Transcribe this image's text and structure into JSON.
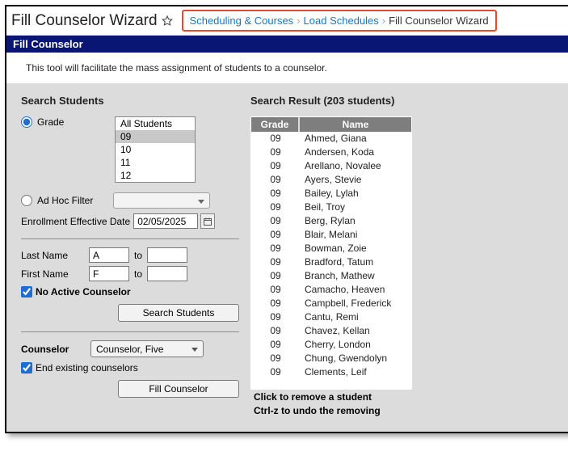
{
  "title": "Fill Counselor Wizard",
  "breadcrumb": {
    "a": "Scheduling & Courses",
    "b": "Load Schedules",
    "c": "Fill Counselor Wizard"
  },
  "banner": "Fill Counselor",
  "intro": "This tool will facilitate the mass assignment of students to a counselor.",
  "search": {
    "heading": "Search Students",
    "grade_label": "Grade",
    "grade_options": {
      "o0": "All Students",
      "o1": "09",
      "o2": "10",
      "o3": "11",
      "o4": "12"
    },
    "adhoc_label": "Ad Hoc Filter",
    "enroll_label": "Enrollment Effective Date",
    "enroll_value": "02/05/2025",
    "lastname_label": "Last Name",
    "lastname_val": "A",
    "to": "to",
    "firstname_label": "First Name",
    "firstname_val": "F",
    "no_active_label": "No Active Counselor",
    "search_btn": "Search Students",
    "counselor_label": "Counselor",
    "counselor_value": "Counselor, Five",
    "end_existing_label": "End existing counselors",
    "fill_btn": "Fill Counselor"
  },
  "results": {
    "heading": "Search Result (203 students)",
    "col_grade": "Grade",
    "col_name": "Name",
    "rows": [
      {
        "g": "09",
        "n": "Ahmed, Giana"
      },
      {
        "g": "09",
        "n": "Andersen, Koda"
      },
      {
        "g": "09",
        "n": "Arellano, Novalee"
      },
      {
        "g": "09",
        "n": "Ayers, Stevie"
      },
      {
        "g": "09",
        "n": "Bailey, Lylah"
      },
      {
        "g": "09",
        "n": "Beil, Troy"
      },
      {
        "g": "09",
        "n": "Berg, Rylan"
      },
      {
        "g": "09",
        "n": "Blair, Melani"
      },
      {
        "g": "09",
        "n": "Bowman, Zoie"
      },
      {
        "g": "09",
        "n": "Bradford, Tatum"
      },
      {
        "g": "09",
        "n": "Branch, Mathew"
      },
      {
        "g": "09",
        "n": "Camacho, Heaven"
      },
      {
        "g": "09",
        "n": "Campbell, Frederick"
      },
      {
        "g": "09",
        "n": "Cantu, Remi"
      },
      {
        "g": "09",
        "n": "Chavez, Kellan"
      },
      {
        "g": "09",
        "n": "Cherry, London"
      },
      {
        "g": "09",
        "n": "Chung, Gwendolyn"
      },
      {
        "g": "09",
        "n": "Clements, Leif"
      }
    ],
    "hint1": "Click to remove a student",
    "hint2": "Ctrl-z to undo the removing"
  }
}
